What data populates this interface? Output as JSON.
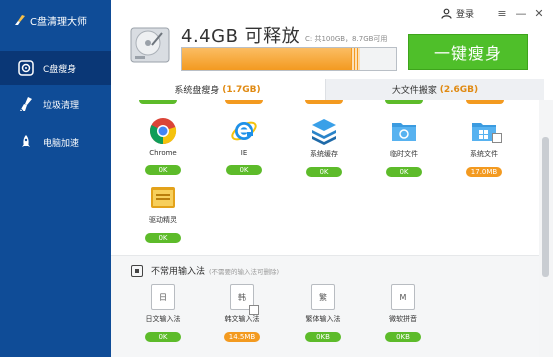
{
  "app": {
    "title": "C盘清理大师"
  },
  "sidebar": {
    "items": [
      {
        "label": "C盘瘦身",
        "icon": "disk-slim-icon",
        "active": true
      },
      {
        "label": "垃圾清理",
        "icon": "broom-icon",
        "active": false
      },
      {
        "label": "电脑加速",
        "icon": "rocket-icon",
        "active": false
      }
    ]
  },
  "topbar": {
    "login_label": "登录",
    "menu_icon": "≡",
    "minimize_icon": "—",
    "close_icon": "✕"
  },
  "header": {
    "free_space": "4.4GB 可释放",
    "capacity": "C: 共100GB，8.7GB可用",
    "usage_fraction": 0.83,
    "slim_button": "一键瘦身"
  },
  "tabs": [
    {
      "label": "系统盘瘦身",
      "value": "(1.7GB)"
    },
    {
      "label": "大文件搬家",
      "value": "(2.6GB)"
    }
  ],
  "grid": {
    "items": [
      {
        "label": "Chrome",
        "badge": "0K",
        "icon": "chrome-icon",
        "checkbox": false
      },
      {
        "label": "IE",
        "badge": "0K",
        "icon": "ie-icon",
        "checkbox": false
      },
      {
        "label": "系统缓存",
        "badge": "0K",
        "icon": "cache-stack-icon",
        "checkbox": false
      },
      {
        "label": "临时文件",
        "badge": "0K",
        "icon": "temp-folder-icon",
        "checkbox": false
      },
      {
        "label": "系统文件",
        "badge": "17.0MB",
        "icon": "system-folder-icon",
        "checkbox": true
      },
      {
        "label": "驱动精灵",
        "badge": "0K",
        "icon": "driver-folder-icon",
        "checkbox": false
      }
    ]
  },
  "ime_section": {
    "title": "不常用输入法",
    "hint": "(不需要的输入法可删除)",
    "items": [
      {
        "label": "日文输入法",
        "glyph": "日",
        "badge": "0K",
        "checkbox": false
      },
      {
        "label": "韩文输入法",
        "glyph": "韩",
        "badge": "14.5MB",
        "checkbox": true
      },
      {
        "label": "繁体输入法",
        "glyph": "繁",
        "badge": "0KB",
        "checkbox": false
      },
      {
        "label": "微软拼音",
        "glyph": "M",
        "badge": "0KB",
        "checkbox": false
      }
    ]
  },
  "colors": {
    "sidebar": "#0f4c97",
    "accent_green": "#4fbf2a",
    "accent_orange": "#f39a20"
  }
}
